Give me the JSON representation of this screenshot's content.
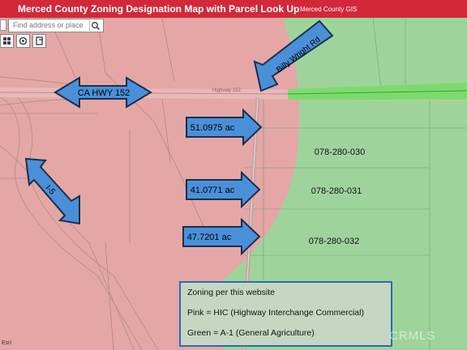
{
  "header": {
    "title": "Merced County Zoning Designation Map with Parcel Look Up",
    "subtitle": "Merced County GIS"
  },
  "search": {
    "placeholder": "Find address or place"
  },
  "tools": [
    "grid-icon",
    "layers-icon",
    "export-icon"
  ],
  "map": {
    "colors": {
      "pink_zone": "#e4a7a6",
      "green_zone": "#9ed49c",
      "highway": "#7ddb6e",
      "arrow_fill": "#4a90d9"
    },
    "labels": {
      "highway": "CA HWY 152",
      "road": "Billy Wright Rd",
      "interstate": "I-5",
      "road_small": "Highway 152"
    },
    "acreage": [
      {
        "label": "51.0975 ac"
      },
      {
        "label": "41.0771 ac"
      },
      {
        "label": "47.7201 ac"
      }
    ],
    "parcels": [
      "078-280-030",
      "078-280-031",
      "078-280-032"
    ]
  },
  "legend": {
    "title": "Zoning per this website",
    "pink": "Pink = HIC (Highway Interchange Commercial)",
    "green": "Green = A-1 (General Agriculture)"
  },
  "footer": {
    "logo_text": "Esri",
    "watermark": "CRMLS"
  }
}
